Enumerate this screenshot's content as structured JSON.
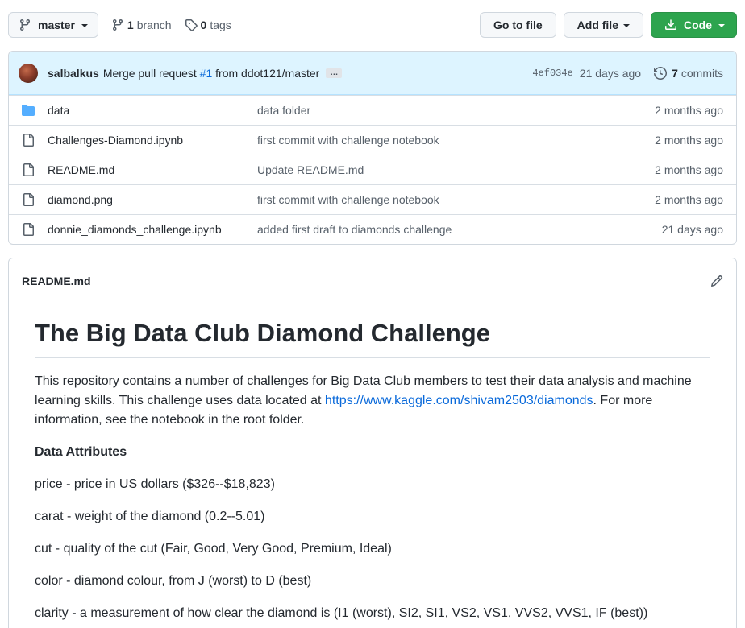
{
  "topbar": {
    "branch_label": "master",
    "branch_count": "1",
    "branch_word": "branch",
    "tag_count": "0",
    "tag_word": "tags",
    "go_to_file": "Go to file",
    "add_file": "Add file",
    "code": "Code"
  },
  "commit": {
    "author": "salbalkus",
    "message_prefix": "Merge pull request",
    "pr_link": "#1",
    "message_suffix": "from ddot121/master",
    "ellipsis": "…",
    "sha": "4ef034e",
    "time": "21 days ago",
    "commit_count": "7",
    "commit_word": "commits"
  },
  "files": [
    {
      "icon": "folder-icon",
      "name": "data",
      "message": "data folder",
      "date": "2 months ago"
    },
    {
      "icon": "file-icon",
      "name": "Challenges-Diamond.ipynb",
      "message": "first commit with challenge notebook",
      "date": "2 months ago"
    },
    {
      "icon": "file-icon",
      "name": "README.md",
      "message": "Update README.md",
      "date": "2 months ago"
    },
    {
      "icon": "file-icon",
      "name": "diamond.png",
      "message": "first commit with challenge notebook",
      "date": "2 months ago"
    },
    {
      "icon": "file-icon",
      "name": "donnie_diamonds_challenge.ipynb",
      "message": "added first draft to diamonds challenge",
      "date": "21 days ago"
    }
  ],
  "readme": {
    "file_label": "README.md",
    "title": "The Big Data Club Diamond Challenge",
    "intro_before_link": "This repository contains a number of challenges for Big Data Club members to test their data analysis and machine learning skills. This challenge uses data located at ",
    "intro_link": "https://www.kaggle.com/shivam2503/diamonds",
    "intro_after_link": ". For more information, see the notebook in the root folder.",
    "attributes_heading": "Data Attributes",
    "attributes": [
      "price - price in US dollars ($326--$18,823)",
      "carat - weight of the diamond (0.2--5.01)",
      "cut - quality of the cut (Fair, Good, Very Good, Premium, Ideal)",
      "color - diamond colour, from J (worst) to D (best)",
      "clarity - a measurement of how clear the diamond is (I1 (worst), SI2, SI1, VS2, VS1, VVS2, VVS1, IF (best))"
    ]
  },
  "colors": {
    "accent_link": "#0969da",
    "code_button": "#2da44e",
    "commit_bg": "#ddf4ff",
    "folder": "#54aeff"
  }
}
